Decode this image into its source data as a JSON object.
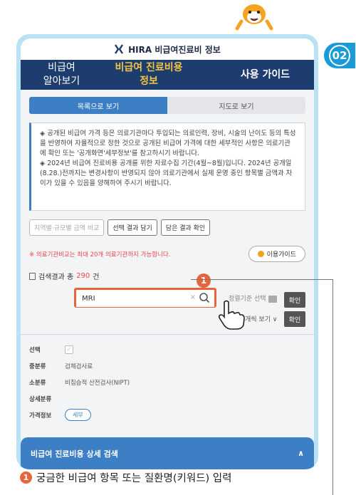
{
  "brand": {
    "title": "HIRA 비급여진료비 정보"
  },
  "step_badge": "02",
  "nav": {
    "item1": "비급여\n알아보기",
    "item2": "비급여 진료비용\n정보",
    "item3": "사용 가이드"
  },
  "tabs": {
    "list": "목록으로 보기",
    "map": "지도로 보기"
  },
  "notice": {
    "p1": "◈ 공개된 비급여 가격 등은 의료기관마다 투입되는 의료인력, 장비, 시술의 난이도 등의 특성을 반영하여 자율적으로 정한 것으로 공개된 비급여 가격에 대한 세부적인 사항은 의료기관에 확인 또는 '공개화면'세부정보'를 참고하시기 바랍니다.",
    "p2": "◈ 2024년 비급여 진료비용 공개를 위한 자료수집 기간(4월~8월)입니다. 2024년 공개일(8.28.)전까지는 변경사항이 반영되지 않아 의료기관에서 실제 운영 중인 항목별 금액과 차이가 있을 수 있음을 양해하여 주시기 바랍니다."
  },
  "buttons": {
    "compare": "지역별·규모별 금액 비교",
    "save_selected": "선택 결과 담기",
    "view_saved": "담은 결과 확인"
  },
  "limit_text": "※ 의료기관비교는 최대 20개 의료기관까지 가능합니다.",
  "guide_button": "이용가이드",
  "result": {
    "prefix": "검색결과 총 ",
    "count": "290",
    "suffix": "건"
  },
  "search": {
    "value": "MRI",
    "clear": "×"
  },
  "badge_one": "1",
  "sort": {
    "label": "정렬기준 선택",
    "confirm": "확인",
    "view": "개씩 보기",
    "confirm2": "확인"
  },
  "detail": {
    "select_label": "선택",
    "category_label": "중분류",
    "category_value": "검체검사료",
    "subcategory_label": "소분류",
    "subcategory_value": "비침습적 산전검사(NIPT)",
    "detail_label": "상세분류",
    "price_label": "가격정보",
    "price_button": "세부"
  },
  "detail_bar": {
    "label": "비급여 진료비용 상세 검색",
    "chevron": "∧"
  },
  "caption": {
    "num": "1",
    "text": "궁금한 비급여 항목 또는 질환명(키워드) 입력"
  },
  "colors": {
    "navy": "#1c3d6e",
    "accent_blue": "#3d7fc4",
    "highlight": "#e8653b",
    "gold": "#f6c445"
  }
}
